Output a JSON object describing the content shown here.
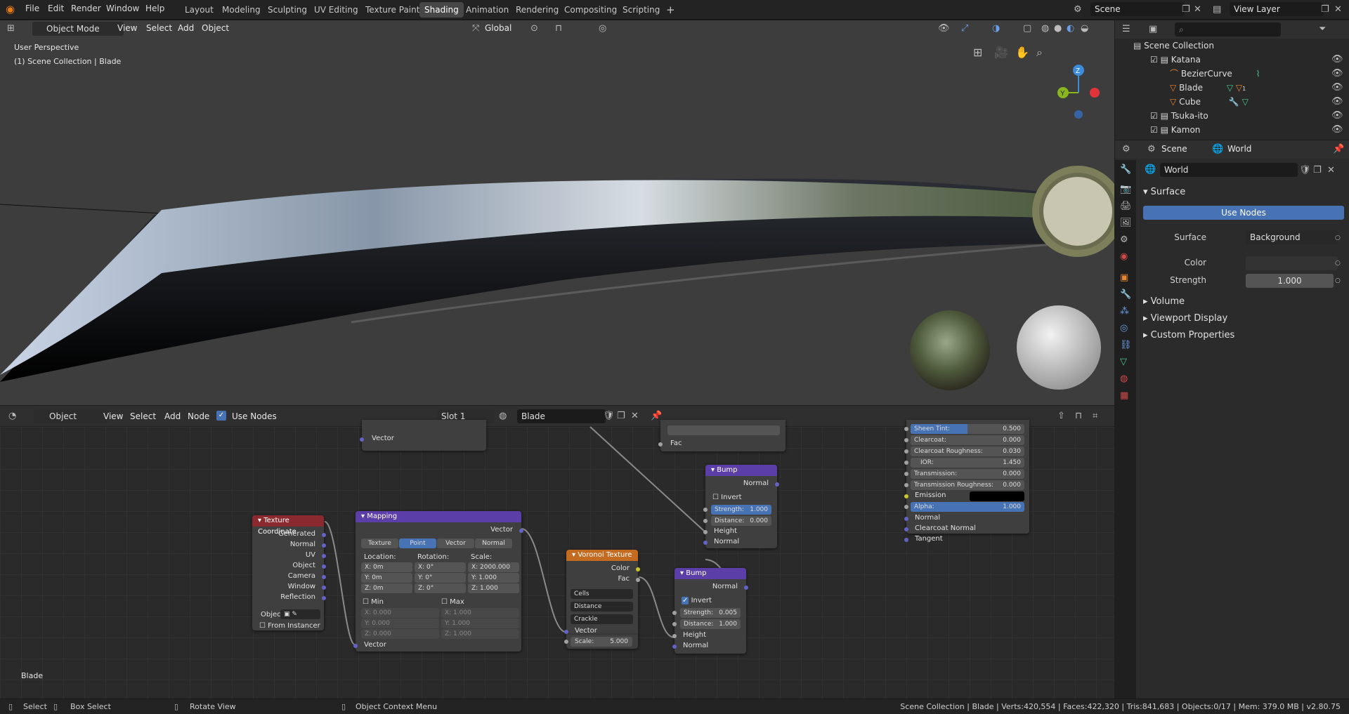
{
  "topbar": {
    "menus": [
      "File",
      "Edit",
      "Render",
      "Window",
      "Help"
    ],
    "workspaces": [
      "Layout",
      "Modeling",
      "Sculpting",
      "UV Editing",
      "Texture Paint",
      "Shading",
      "Animation",
      "Rendering",
      "Compositing",
      "Scripting"
    ],
    "active_workspace": "Shading",
    "add_tab": "+",
    "scene": "Scene",
    "view_layer": "View Layer"
  },
  "viewport": {
    "mode": "Object Mode",
    "menus": [
      "View",
      "Select",
      "Add",
      "Object"
    ],
    "transform": "Global",
    "overlay_title": "User Perspective",
    "overlay_sub": "(1) Scene Collection | Blade",
    "gizmo": {
      "z": "Z",
      "y": "Y"
    }
  },
  "outliner": {
    "root": "Scene Collection",
    "items": [
      {
        "label": "Katana",
        "level": 1
      },
      {
        "label": "BezierCurve",
        "level": 2
      },
      {
        "label": "Blade",
        "level": 2,
        "badge": "1"
      },
      {
        "label": "Cube",
        "level": 2
      },
      {
        "label": "Tsuka-ito",
        "level": 1
      },
      {
        "label": "Kamon",
        "level": 1
      }
    ]
  },
  "properties": {
    "tab_scene": "Scene",
    "tab_world": "World",
    "world_name": "World",
    "surface_panel": "Surface",
    "use_nodes": "Use Nodes",
    "surface_label": "Surface",
    "surface_value": "Background",
    "color_label": "Color",
    "strength_label": "Strength",
    "strength_value": "1.000",
    "panels": [
      "Volume",
      "Viewport Display",
      "Custom Properties"
    ]
  },
  "node_editor": {
    "type": "Object",
    "menus": [
      "View",
      "Select",
      "Add",
      "Node"
    ],
    "use_nodes": "Use Nodes",
    "slot": "Slot 1",
    "material": "Blade",
    "object_label": "Blade",
    "texcoord": {
      "title": "Texture Coordinate",
      "outputs": [
        "Generated",
        "Normal",
        "UV",
        "Object",
        "Camera",
        "Window",
        "Reflection"
      ],
      "object_field": "Objec",
      "from_instancer": "From Instancer"
    },
    "mapping": {
      "title": "Mapping",
      "out": "Vector",
      "types": [
        "Texture",
        "Point",
        "Vector",
        "Normal"
      ],
      "active_type": "Point",
      "loc_label": "Location:",
      "rot_label": "Rotation:",
      "scale_label": "Scale:",
      "loc": [
        "X:      0m",
        "Y:      0m",
        "Z:      0m"
      ],
      "rot": [
        "X:      0°",
        "Y:      0°",
        "Z:      0°"
      ],
      "scale": [
        "X: 2000.000",
        "Y:     1.000",
        "Z:     1.000"
      ],
      "min": "Min",
      "max": "Max",
      "min_vals": [
        "X:      0.000",
        "Y:      0.000",
        "Z:      0.000"
      ],
      "max_vals": [
        "X:      1.000",
        "Y:      1.000",
        "Z:      1.000"
      ],
      "in": "Vector"
    },
    "voronoi": {
      "title": "Voronoi Texture",
      "outputs": [
        "Color",
        "Fac"
      ],
      "dropdowns": [
        "Cells",
        "Distance",
        "Crackle"
      ],
      "in": "Vector",
      "scale_label": "Scale:",
      "scale": "5.000"
    },
    "bump1": {
      "title": "Bump",
      "out": "Normal",
      "invert": "Invert",
      "strength_label": "Strength:",
      "strength": "1.000",
      "distance_label": "Distance:",
      "distance": "0.000",
      "inputs": [
        "Height",
        "Normal"
      ]
    },
    "bump2": {
      "title": "Bump",
      "out": "Normal",
      "invert": "Invert",
      "strength_label": "Strength:",
      "strength": "0.005",
      "distance_label": "Distance:",
      "distance": "1.000",
      "inputs": [
        "Height",
        "Normal"
      ]
    },
    "top_partial": {
      "vector": "Vector",
      "fac": "Fac"
    },
    "principled": {
      "rows": [
        {
          "label": "Sheen Tint:",
          "value": "0.500",
          "fill": 0.5
        },
        {
          "label": "Clearcoat:",
          "value": "0.000"
        },
        {
          "label": "Clearcoat Roughness:",
          "value": "0.030"
        },
        {
          "label": "IOR:",
          "value": "1.450"
        },
        {
          "label": "Transmission:",
          "value": "0.000"
        },
        {
          "label": "Transmission Roughness:",
          "value": "0.000"
        }
      ],
      "emission": "Emission",
      "alpha_label": "Alpha:",
      "alpha": "1.000",
      "inputs": [
        "Normal",
        "Clearcoat Normal",
        "Tangent"
      ]
    }
  },
  "status": {
    "select": "Select",
    "box_select": "Box Select",
    "rotate": "Rotate View",
    "context": "Object Context Menu",
    "info": "Scene Collection | Blade | Verts:420,554 | Faces:422,320 | Tris:841,683 | Objects:0/17 | Mem: 379.0 MB | v2.80.75"
  },
  "colors": {
    "accent": "#4772b3",
    "tex_header": "#8b2a2e",
    "vector_header": "#5c3ea8",
    "texture_header": "#c36b21"
  }
}
